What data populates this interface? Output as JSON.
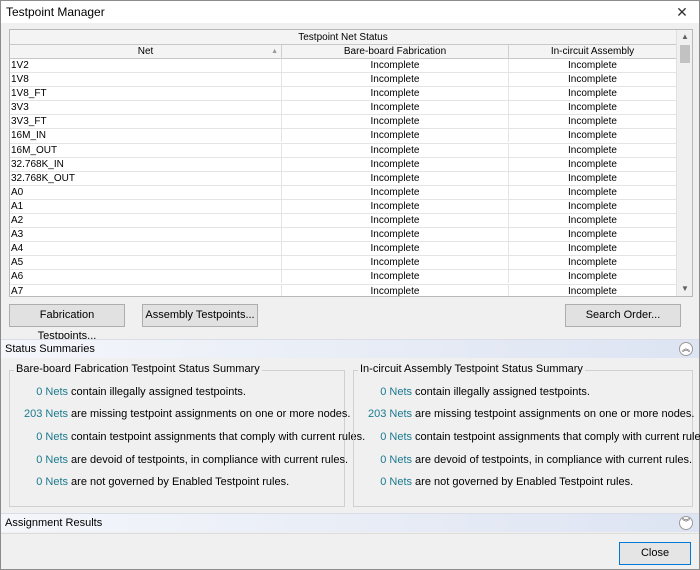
{
  "window": {
    "title": "Testpoint Manager",
    "close_glyph": "✕"
  },
  "grid": {
    "group_header": "Testpoint Net Status",
    "columns": [
      "Net",
      "Bare-board Fabrication",
      "In-circuit Assembly"
    ],
    "rows": [
      {
        "net": "1V2",
        "fab": "Incomplete",
        "asm": "Incomplete"
      },
      {
        "net": "1V8",
        "fab": "Incomplete",
        "asm": "Incomplete"
      },
      {
        "net": "1V8_FT",
        "fab": "Incomplete",
        "asm": "Incomplete"
      },
      {
        "net": "3V3",
        "fab": "Incomplete",
        "asm": "Incomplete"
      },
      {
        "net": "3V3_FT",
        "fab": "Incomplete",
        "asm": "Incomplete"
      },
      {
        "net": "16M_IN",
        "fab": "Incomplete",
        "asm": "Incomplete"
      },
      {
        "net": "16M_OUT",
        "fab": "Incomplete",
        "asm": "Incomplete"
      },
      {
        "net": "32.768K_IN",
        "fab": "Incomplete",
        "asm": "Incomplete"
      },
      {
        "net": "32.768K_OUT",
        "fab": "Incomplete",
        "asm": "Incomplete"
      },
      {
        "net": "A0",
        "fab": "Incomplete",
        "asm": "Incomplete"
      },
      {
        "net": "A1",
        "fab": "Incomplete",
        "asm": "Incomplete"
      },
      {
        "net": "A2",
        "fab": "Incomplete",
        "asm": "Incomplete"
      },
      {
        "net": "A3",
        "fab": "Incomplete",
        "asm": "Incomplete"
      },
      {
        "net": "A4",
        "fab": "Incomplete",
        "asm": "Incomplete"
      },
      {
        "net": "A5",
        "fab": "Incomplete",
        "asm": "Incomplete"
      },
      {
        "net": "A6",
        "fab": "Incomplete",
        "asm": "Incomplete"
      },
      {
        "net": "A7",
        "fab": "Incomplete",
        "asm": "Incomplete"
      }
    ]
  },
  "buttons": {
    "fabrication": "Fabrication Testpoints...",
    "assembly": "Assembly Testpoints...",
    "search_order": "Search Order...",
    "close": "Close"
  },
  "status_summaries": {
    "header": "Status Summaries",
    "fabrication": {
      "title": "Bare-board Fabrication Testpoint Status Summary",
      "lines": [
        {
          "count": "0 Nets",
          "text": " contain illegally assigned testpoints."
        },
        {
          "count": "203 Nets",
          "text": " are missing testpoint assignments on one or more nodes."
        },
        {
          "count": "0 Nets",
          "text": " contain testpoint assignments that comply with current rules."
        },
        {
          "count": "0 Nets",
          "text": " are devoid of testpoints, in compliance with current rules."
        },
        {
          "count": "0 Nets",
          "text": " are not governed by Enabled Testpoint rules."
        }
      ]
    },
    "assembly": {
      "title": "In-circuit Assembly Testpoint Status Summary",
      "lines": [
        {
          "count": "0 Nets",
          "text": " contain illegally assigned testpoints."
        },
        {
          "count": "203 Nets",
          "text": " are missing testpoint assignments on one or more nodes."
        },
        {
          "count": "0 Nets",
          "text": " contain testpoint assignments that comply with current rules."
        },
        {
          "count": "0 Nets",
          "text": " are devoid of testpoints, in compliance with current rules."
        },
        {
          "count": "0 Nets",
          "text": " are not governed by Enabled Testpoint rules."
        }
      ]
    }
  },
  "assignment_results": {
    "header": "Assignment Results"
  },
  "icons": {
    "collapse_up": "︽",
    "expand_down": "︾",
    "scroll_up": "▲",
    "scroll_down": "▼",
    "sort": "▲"
  }
}
